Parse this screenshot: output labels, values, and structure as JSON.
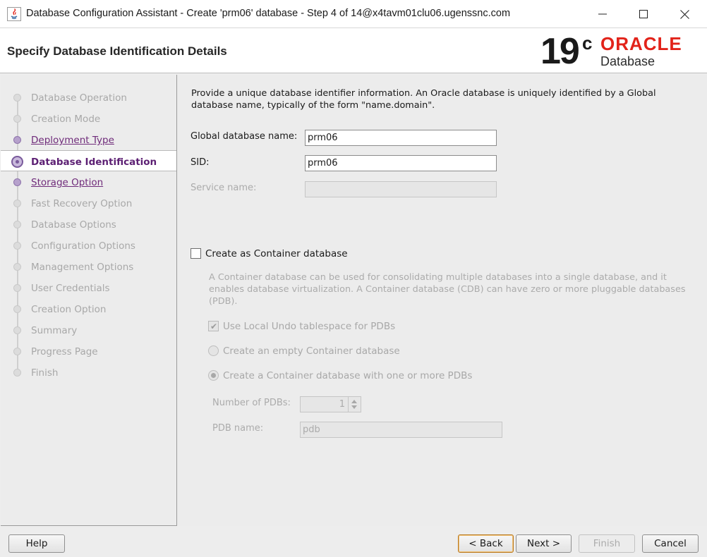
{
  "window": {
    "title": "Database Configuration Assistant - Create 'prm06' database - Step 4 of 14@x4tavm01clu06.ugenssnc.com"
  },
  "header": {
    "title": "Specify Database Identification Details",
    "logo_version": "19",
    "logo_superscript": "c",
    "logo_brand": "ORACLE",
    "logo_product": "Database"
  },
  "steps": [
    {
      "label": "Database Operation",
      "state": "disabled"
    },
    {
      "label": "Creation Mode",
      "state": "disabled"
    },
    {
      "label": "Deployment Type",
      "state": "link"
    },
    {
      "label": "Database Identification",
      "state": "current"
    },
    {
      "label": "Storage Option",
      "state": "link"
    },
    {
      "label": "Fast Recovery Option",
      "state": "disabled"
    },
    {
      "label": "Database Options",
      "state": "disabled"
    },
    {
      "label": "Configuration Options",
      "state": "disabled"
    },
    {
      "label": "Management Options",
      "state": "disabled"
    },
    {
      "label": "User Credentials",
      "state": "disabled"
    },
    {
      "label": "Creation Option",
      "state": "disabled"
    },
    {
      "label": "Summary",
      "state": "disabled"
    },
    {
      "label": "Progress Page",
      "state": "disabled"
    },
    {
      "label": "Finish",
      "state": "disabled"
    }
  ],
  "form": {
    "intro": "Provide a unique database identifier information. An Oracle database is uniquely identified by a Global database name, typically of the form \"name.domain\".",
    "global_db_name_label": "Global database name:",
    "global_db_name_value": "prm06",
    "sid_label": "SID:",
    "sid_value": "prm06",
    "service_name_label": "Service name:",
    "service_name_value": "",
    "container_checkbox_label": "Create as Container database",
    "container_checked": false,
    "container_description": "A Container database can be used for consolidating multiple databases into a single database, and it enables database virtualization. A Container database (CDB) can have zero or more pluggable databases (PDB).",
    "local_undo_label": "Use Local Undo tablespace for PDBs",
    "local_undo_checked": true,
    "empty_container_label": "Create an empty Container database",
    "with_pdbs_label": "Create a Container database with one or more PDBs",
    "num_pdbs_label": "Number of PDBs:",
    "num_pdbs_value": "1",
    "pdb_name_label": "PDB name:",
    "pdb_name_value": "pdb"
  },
  "buttons": {
    "help": "Help",
    "back": "< Back",
    "next": "Next >",
    "finish": "Finish",
    "cancel": "Cancel"
  }
}
